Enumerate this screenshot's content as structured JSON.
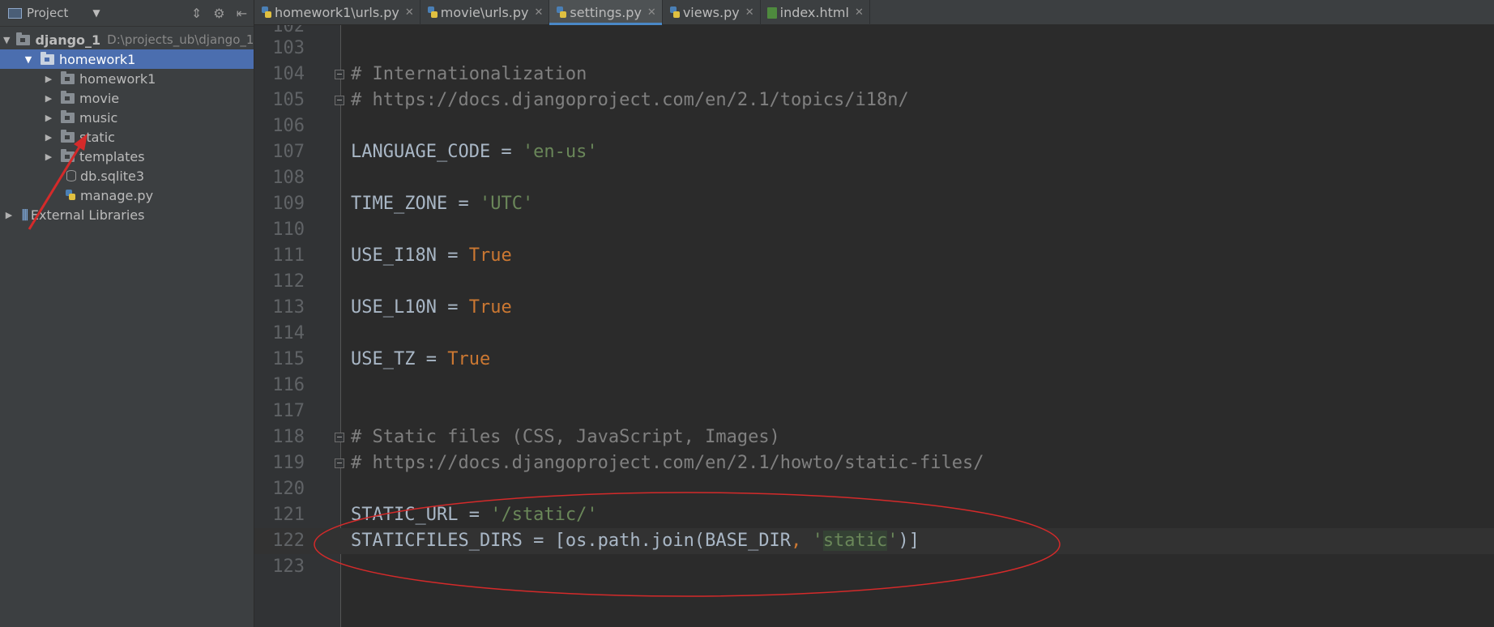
{
  "project_panel": {
    "title": "Project",
    "root": {
      "name": "django_1",
      "path": "D:\\projects_ub\\django_1"
    },
    "items": [
      {
        "label": "homework1",
        "kind": "folder"
      },
      {
        "label": "homework1",
        "kind": "folder"
      },
      {
        "label": "movie",
        "kind": "folder"
      },
      {
        "label": "music",
        "kind": "folder"
      },
      {
        "label": "static",
        "kind": "folder"
      },
      {
        "label": "templates",
        "kind": "folder"
      },
      {
        "label": "db.sqlite3",
        "kind": "file"
      },
      {
        "label": "manage.py",
        "kind": "file"
      },
      {
        "label": "External Libraries",
        "kind": "library"
      }
    ]
  },
  "tabs": [
    {
      "label": "homework1\\urls.py",
      "icon": "python-file-icon"
    },
    {
      "label": "movie\\urls.py",
      "icon": "python-file-icon"
    },
    {
      "label": "settings.py",
      "icon": "python-file-icon",
      "active": true
    },
    {
      "label": "views.py",
      "icon": "python-file-icon"
    },
    {
      "label": "index.html",
      "icon": "html-file-icon"
    }
  ],
  "editor": {
    "lines": [
      {
        "n": "102"
      },
      {
        "n": "103"
      },
      {
        "n": "104",
        "comment": "# Internationalization"
      },
      {
        "n": "105",
        "comment": "# https://docs.djangoproject.com/en/2.1/topics/i18n/"
      },
      {
        "n": "106"
      },
      {
        "n": "107",
        "name": "LANGUAGE_CODE",
        "op": " = ",
        "str": "'en-us'"
      },
      {
        "n": "108"
      },
      {
        "n": "109",
        "name": "TIME_ZONE",
        "op": " = ",
        "str": "'UTC'"
      },
      {
        "n": "110"
      },
      {
        "n": "111",
        "name": "USE_I18N",
        "op": " = ",
        "kw": "True"
      },
      {
        "n": "112"
      },
      {
        "n": "113",
        "name": "USE_L10N",
        "op": " = ",
        "kw": "True"
      },
      {
        "n": "114"
      },
      {
        "n": "115",
        "name": "USE_TZ",
        "op": " = ",
        "kw": "True"
      },
      {
        "n": "116"
      },
      {
        "n": "117"
      },
      {
        "n": "118",
        "comment": "# Static files (CSS, JavaScript, Images)"
      },
      {
        "n": "119",
        "comment": "# https://docs.djangoproject.com/en/2.1/howto/static-files/"
      },
      {
        "n": "120"
      },
      {
        "n": "121",
        "name": "STATIC_URL",
        "op": " = ",
        "str": "'/static/'"
      },
      {
        "n": "122",
        "head": "STATICFILES_DIRS = [os.path.join(BASE_DIR",
        "sep": ", ",
        "q1": "'",
        "hl": "static",
        "q2": "'",
        "tail": ")]"
      },
      {
        "n": "123"
      }
    ]
  },
  "colors": {
    "selection": "#4b6eaf",
    "annotation_red": "#d42a2a",
    "string_green": "#6a8759",
    "keyword_orange": "#cc7832"
  }
}
